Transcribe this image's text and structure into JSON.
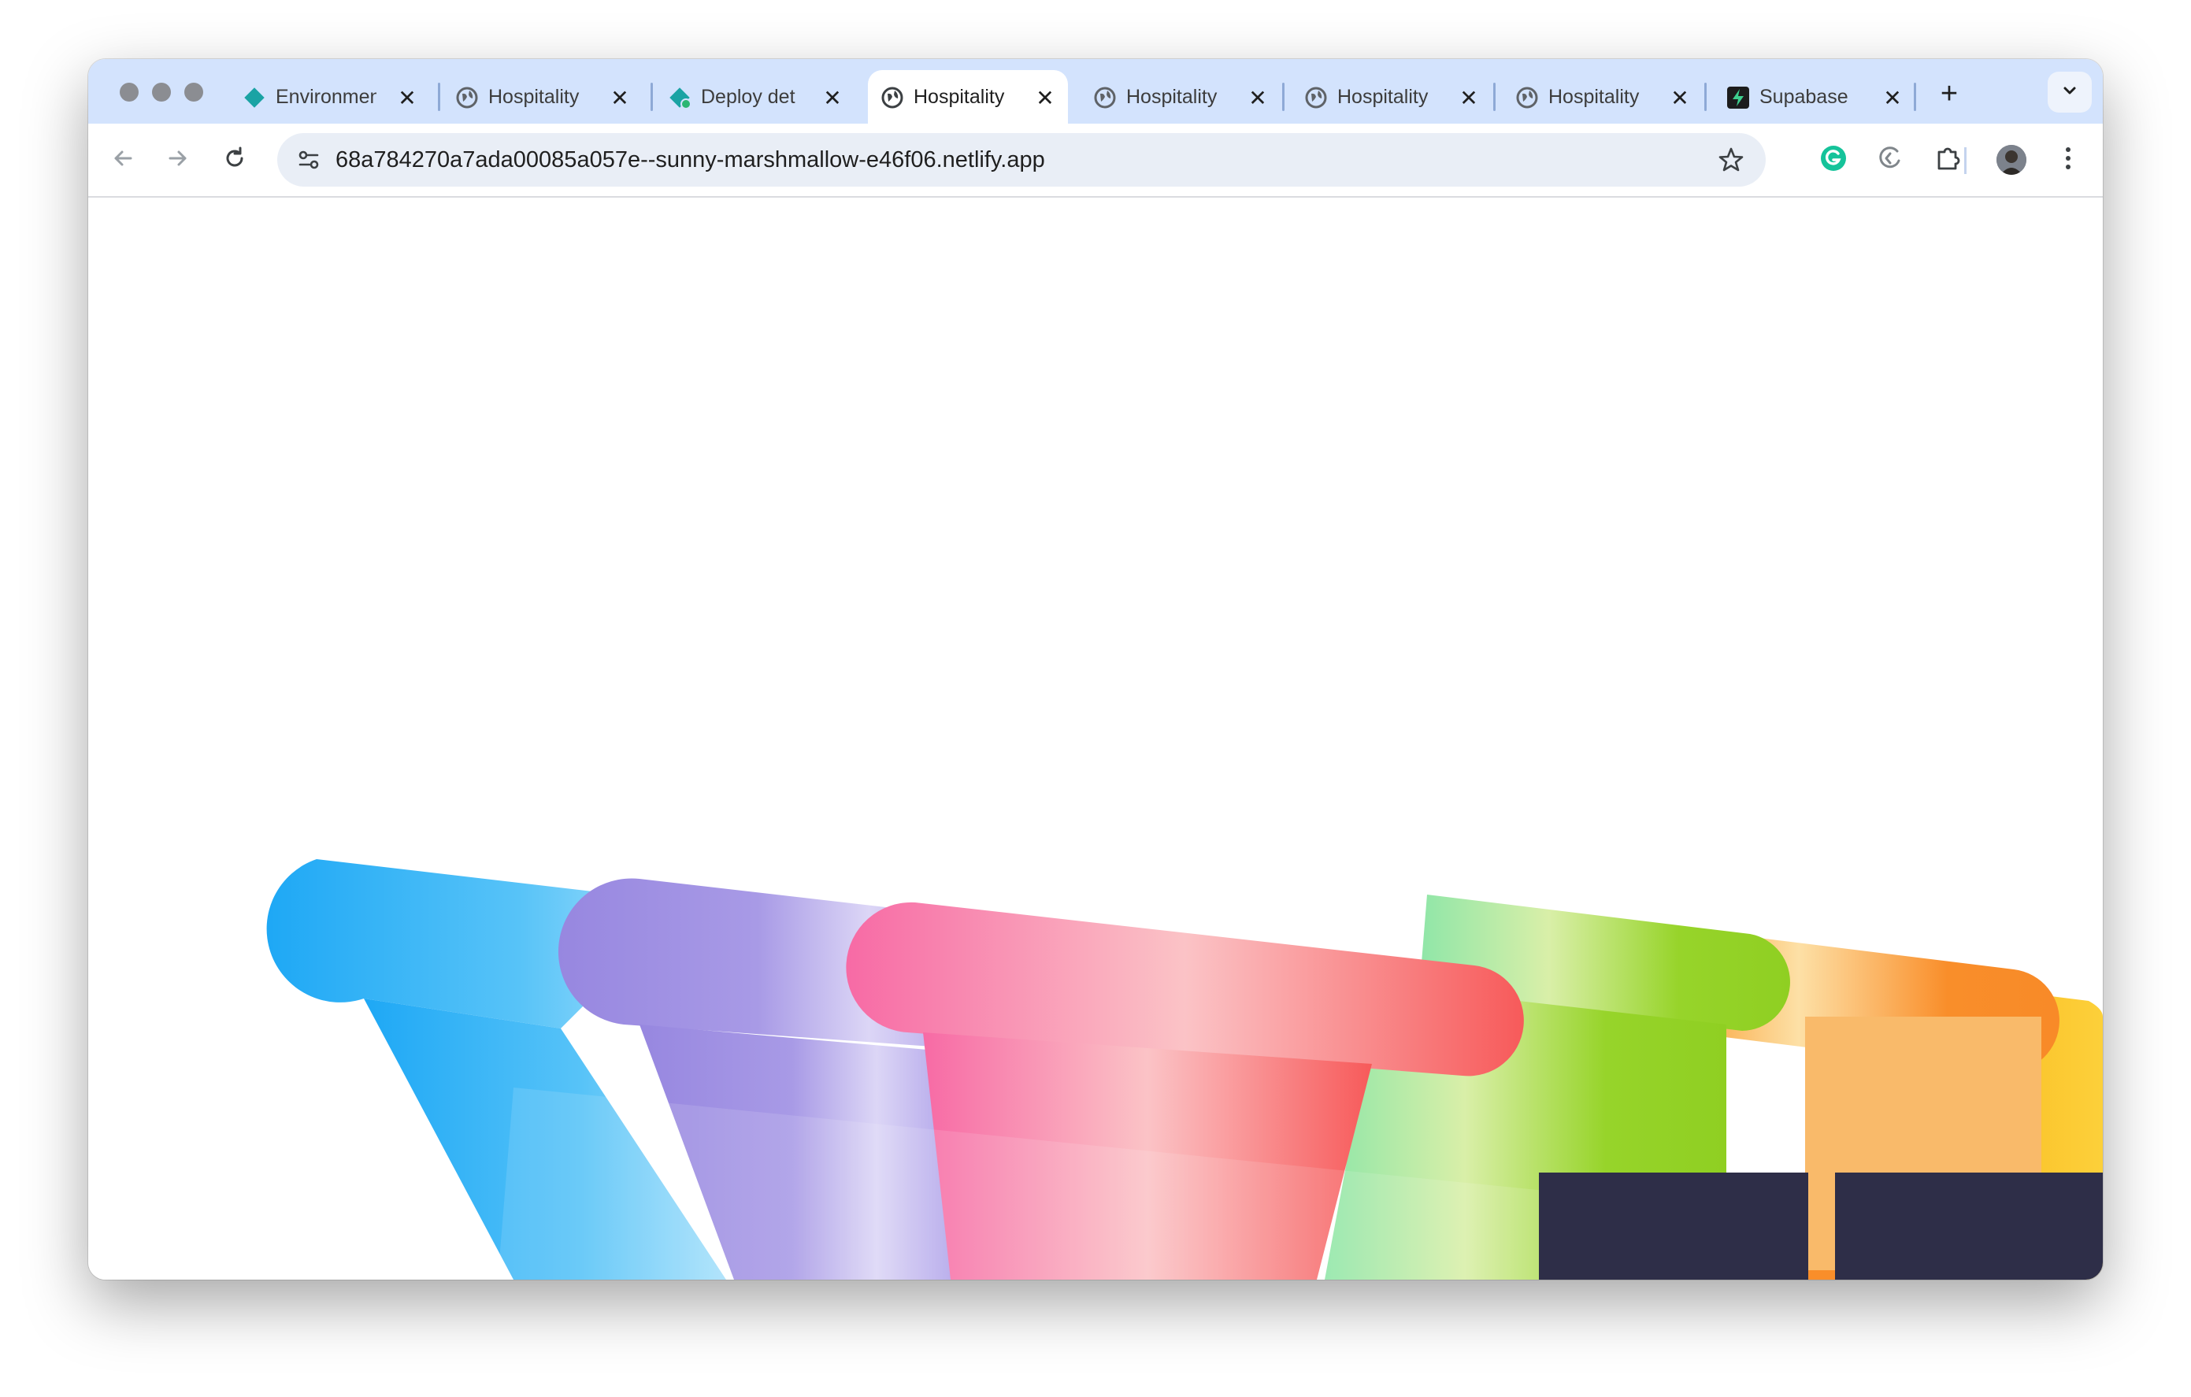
{
  "browser": {
    "tabs": [
      {
        "title": "Environmen",
        "favicon": "netlify-icon",
        "active": false
      },
      {
        "title": "Hospitality",
        "favicon": "globe-icon",
        "active": false
      },
      {
        "title": "Deploy det",
        "favicon": "netlify-deploy-icon",
        "active": false
      },
      {
        "title": "Hospitality",
        "favicon": "globe-icon",
        "active": true
      },
      {
        "title": "Hospitality",
        "favicon": "globe-icon",
        "active": false
      },
      {
        "title": "Hospitality",
        "favicon": "globe-icon",
        "active": false
      },
      {
        "title": "Hospitality",
        "favicon": "globe-icon",
        "active": false
      },
      {
        "title": "Supabase",
        "favicon": "supabase-icon",
        "active": false
      }
    ],
    "new_tab_symbol": "+",
    "close_symbol": "✕",
    "address_bar": {
      "url": "68a784270a7ada00085a057e--sunny-marshmallow-e46f06.netlify.app"
    },
    "colors": {
      "tabstrip": "#d3e3fd",
      "omnibox": "#e9eef6"
    }
  },
  "page": {
    "graphic": {
      "description_colors": [
        "#1ea8f5",
        "#9b8ae2",
        "#f76aa5",
        "#97d42a",
        "#f98e2a",
        "#fbc52d",
        "#2e2e48"
      ]
    }
  }
}
